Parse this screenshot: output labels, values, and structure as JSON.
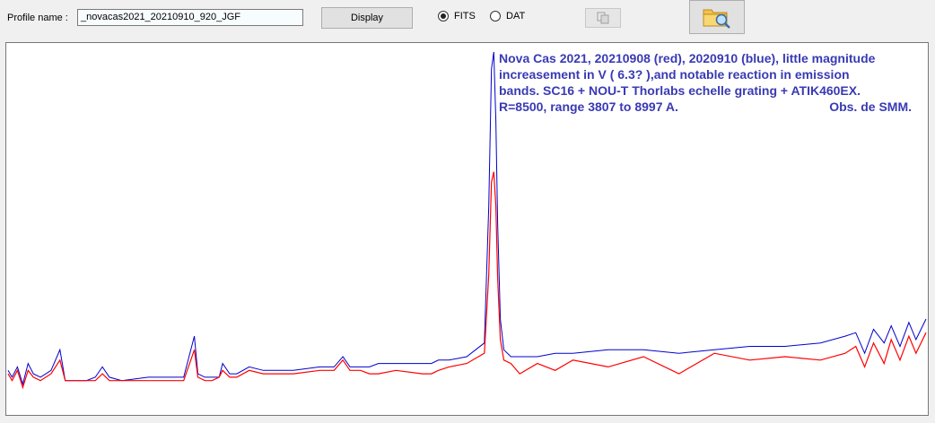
{
  "toolbar": {
    "profile_label": "Profile name :",
    "profile_value": "_novacas2021_20210910_920_JGF",
    "display_label": "Display",
    "format_options": [
      {
        "label": "FITS",
        "selected": true
      },
      {
        "label": "DAT",
        "selected": false
      }
    ],
    "copy_icon": "copy-icon",
    "open_icon": "folder-search-icon"
  },
  "plot": {
    "annotation_lines": [
      "Nova Cas 2021, 20210908 (red), 2020910 (blue), little magnitude",
      "increasement in V ( 6.3? ),and notable reaction in emission",
      "bands. SC16 + NOU-T Thorlabs echelle grating + ATIK460EX."
    ],
    "annotation_last_left": "R=8500, range 3807 to 8997 A.",
    "annotation_last_right": "Obs. de SMM.",
    "colors": {
      "red": "#ff0000",
      "blue": "#0000cc",
      "annotation": "#3a3ab4"
    }
  },
  "chart_data": {
    "type": "line",
    "x_range": [
      3807,
      8997
    ],
    "x_unit": "A",
    "series": [
      {
        "color": "#0000cc",
        "points": [
          [
            3807,
            0.07
          ],
          [
            3830,
            0.05
          ],
          [
            3860,
            0.08
          ],
          [
            3890,
            0.03
          ],
          [
            3920,
            0.09
          ],
          [
            3950,
            0.06
          ],
          [
            3990,
            0.05
          ],
          [
            4050,
            0.07
          ],
          [
            4100,
            0.13
          ],
          [
            4130,
            0.04
          ],
          [
            4180,
            0.04
          ],
          [
            4250,
            0.04
          ],
          [
            4300,
            0.05
          ],
          [
            4340,
            0.08
          ],
          [
            4380,
            0.05
          ],
          [
            4450,
            0.04
          ],
          [
            4600,
            0.05
          ],
          [
            4800,
            0.05
          ],
          [
            4860,
            0.17
          ],
          [
            4880,
            0.06
          ],
          [
            4920,
            0.05
          ],
          [
            4960,
            0.05
          ],
          [
            5000,
            0.05
          ],
          [
            5020,
            0.09
          ],
          [
            5060,
            0.06
          ],
          [
            5100,
            0.06
          ],
          [
            5170,
            0.08
          ],
          [
            5250,
            0.07
          ],
          [
            5300,
            0.07
          ],
          [
            5420,
            0.07
          ],
          [
            5570,
            0.08
          ],
          [
            5650,
            0.08
          ],
          [
            5700,
            0.11
          ],
          [
            5740,
            0.08
          ],
          [
            5800,
            0.08
          ],
          [
            5850,
            0.08
          ],
          [
            5900,
            0.09
          ],
          [
            6000,
            0.09
          ],
          [
            6150,
            0.09
          ],
          [
            6200,
            0.09
          ],
          [
            6240,
            0.1
          ],
          [
            6300,
            0.1
          ],
          [
            6400,
            0.11
          ],
          [
            6500,
            0.15
          ],
          [
            6525,
            0.55
          ],
          [
            6540,
            0.95
          ],
          [
            6553,
            1.0
          ],
          [
            6565,
            0.8
          ],
          [
            6575,
            0.5
          ],
          [
            6590,
            0.22
          ],
          [
            6610,
            0.13
          ],
          [
            6650,
            0.11
          ],
          [
            6700,
            0.11
          ],
          [
            6800,
            0.11
          ],
          [
            6900,
            0.12
          ],
          [
            7000,
            0.12
          ],
          [
            7200,
            0.13
          ],
          [
            7400,
            0.13
          ],
          [
            7600,
            0.12
          ],
          [
            7800,
            0.13
          ],
          [
            8000,
            0.14
          ],
          [
            8200,
            0.14
          ],
          [
            8400,
            0.15
          ],
          [
            8540,
            0.17
          ],
          [
            8600,
            0.18
          ],
          [
            8650,
            0.12
          ],
          [
            8700,
            0.19
          ],
          [
            8760,
            0.15
          ],
          [
            8800,
            0.2
          ],
          [
            8850,
            0.14
          ],
          [
            8900,
            0.21
          ],
          [
            8940,
            0.16
          ],
          [
            8997,
            0.22
          ]
        ]
      },
      {
        "color": "#ff0000",
        "points": [
          [
            3807,
            0.06
          ],
          [
            3830,
            0.04
          ],
          [
            3860,
            0.07
          ],
          [
            3890,
            0.02
          ],
          [
            3920,
            0.07
          ],
          [
            3950,
            0.05
          ],
          [
            3990,
            0.04
          ],
          [
            4050,
            0.06
          ],
          [
            4100,
            0.1
          ],
          [
            4130,
            0.04
          ],
          [
            4180,
            0.04
          ],
          [
            4250,
            0.04
          ],
          [
            4300,
            0.04
          ],
          [
            4340,
            0.06
          ],
          [
            4380,
            0.04
          ],
          [
            4450,
            0.04
          ],
          [
            4600,
            0.04
          ],
          [
            4800,
            0.04
          ],
          [
            4860,
            0.13
          ],
          [
            4880,
            0.05
          ],
          [
            4920,
            0.04
          ],
          [
            4960,
            0.04
          ],
          [
            5000,
            0.05
          ],
          [
            5020,
            0.07
          ],
          [
            5060,
            0.05
          ],
          [
            5100,
            0.05
          ],
          [
            5170,
            0.07
          ],
          [
            5250,
            0.06
          ],
          [
            5300,
            0.06
          ],
          [
            5420,
            0.06
          ],
          [
            5570,
            0.07
          ],
          [
            5650,
            0.07
          ],
          [
            5700,
            0.1
          ],
          [
            5740,
            0.07
          ],
          [
            5800,
            0.07
          ],
          [
            5850,
            0.06
          ],
          [
            5900,
            0.06
          ],
          [
            6000,
            0.07
          ],
          [
            6150,
            0.06
          ],
          [
            6200,
            0.06
          ],
          [
            6240,
            0.07
          ],
          [
            6300,
            0.08
          ],
          [
            6400,
            0.09
          ],
          [
            6500,
            0.12
          ],
          [
            6525,
            0.35
          ],
          [
            6540,
            0.62
          ],
          [
            6553,
            0.65
          ],
          [
            6565,
            0.55
          ],
          [
            6575,
            0.34
          ],
          [
            6590,
            0.16
          ],
          [
            6610,
            0.1
          ],
          [
            6650,
            0.09
          ],
          [
            6700,
            0.06
          ],
          [
            6800,
            0.09
          ],
          [
            6900,
            0.07
          ],
          [
            7000,
            0.1
          ],
          [
            7200,
            0.08
          ],
          [
            7400,
            0.11
          ],
          [
            7600,
            0.06
          ],
          [
            7800,
            0.12
          ],
          [
            8000,
            0.1
          ],
          [
            8200,
            0.11
          ],
          [
            8400,
            0.1
          ],
          [
            8540,
            0.12
          ],
          [
            8600,
            0.14
          ],
          [
            8650,
            0.08
          ],
          [
            8700,
            0.15
          ],
          [
            8760,
            0.09
          ],
          [
            8800,
            0.16
          ],
          [
            8850,
            0.1
          ],
          [
            8900,
            0.17
          ],
          [
            8940,
            0.12
          ],
          [
            8997,
            0.18
          ]
        ]
      }
    ]
  }
}
